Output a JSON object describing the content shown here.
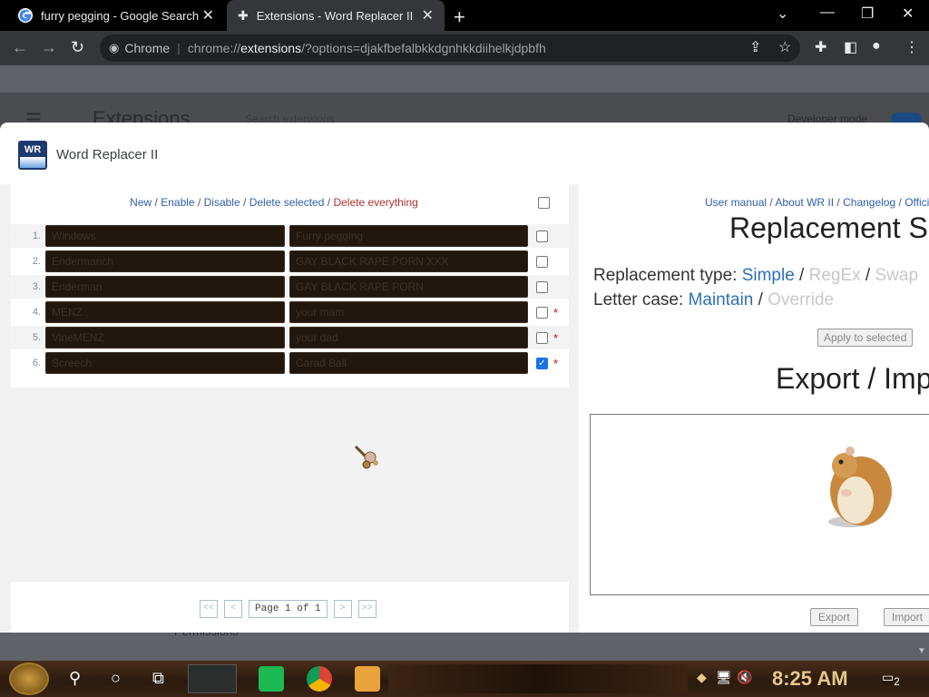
{
  "browser": {
    "tabs": [
      {
        "title": "furry pegging - Google Search",
        "favicon": "google-icon"
      },
      {
        "title": "Extensions - Word Replacer II",
        "favicon": "puzzle-icon"
      }
    ],
    "omnibox": {
      "site": "Chrome",
      "url_scheme": "chrome://",
      "url_host": "extensions",
      "url_rest": "/?options=djakfbefalbkkdgnhkkdiihelkjdpbfh"
    }
  },
  "extensions_page": {
    "title": "Extensions",
    "search_placeholder": "Search extensions",
    "developer_mode_label": "Developer mode",
    "permissions_label": "Permissions"
  },
  "dialog": {
    "title": "Word Replacer II",
    "logo_text": "WR"
  },
  "rules": {
    "actions": {
      "new": "New",
      "enable": "Enable",
      "disable": "Disable",
      "delete_selected": "Delete selected",
      "delete_everything": "Delete everything",
      "sep": "/"
    },
    "rows": [
      {
        "num": "1.",
        "from": "Windows",
        "to": "Furry pegging",
        "checked": false,
        "star": ""
      },
      {
        "num": "2.",
        "from": "Endermanch",
        "to": "GAY BLACK RAPE PORN XXX",
        "checked": false,
        "star": ""
      },
      {
        "num": "3.",
        "from": "Enderman",
        "to": "GAY BLACK RAPE PORN",
        "checked": false,
        "star": ""
      },
      {
        "num": "4.",
        "from": "MENZ",
        "to": "your mam",
        "checked": false,
        "star": "*"
      },
      {
        "num": "5.",
        "from": "VineMENZ",
        "to": "your dad",
        "checked": false,
        "star": "*"
      },
      {
        "num": "6.",
        "from": "Screech",
        "to": "Carad Ball",
        "checked": true,
        "star": "*"
      }
    ],
    "pager": {
      "first": "<<",
      "prev": "<",
      "page": "Page 1 of 1",
      "next": ">",
      "last": ">>"
    }
  },
  "settings": {
    "links": {
      "manual": "User manual",
      "about": "About WR II",
      "changelog": "Changelog",
      "official": "Offici",
      "sep": "/"
    },
    "title": "Replacement Se",
    "type_label": "Replacement type:",
    "type_options": {
      "simple": "Simple",
      "regex": "RegEx",
      "swap": "Swap"
    },
    "case_label": "Letter case:",
    "case_options": {
      "maintain": "Maintain",
      "override": "Override"
    },
    "apply_label": "Apply to selected",
    "export_title": "Export / Imp",
    "export_button": "Export",
    "import_button": "Import"
  },
  "taskbar": {
    "clock": "8:25 AM",
    "notification_count": "2"
  }
}
